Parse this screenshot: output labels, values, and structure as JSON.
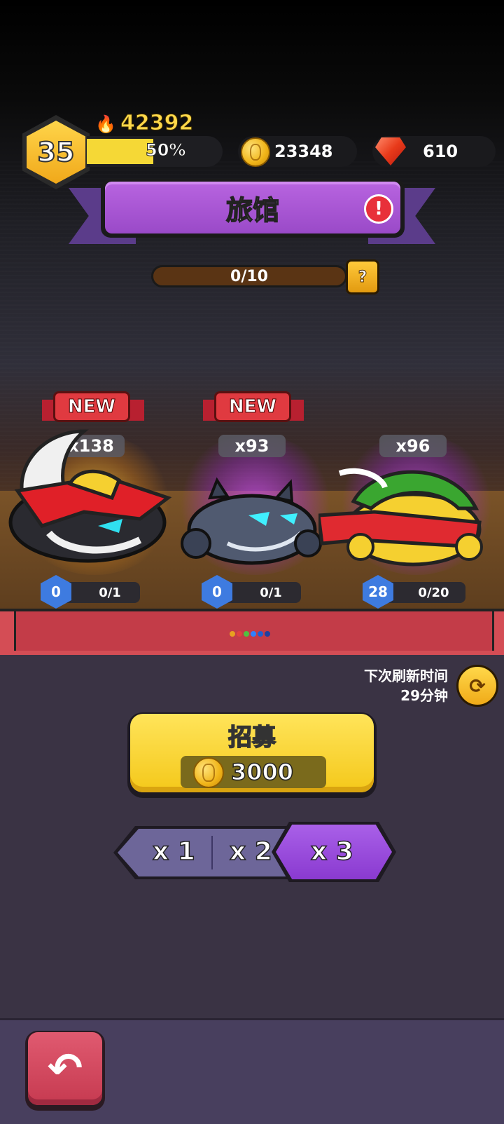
{
  "player": {
    "level": "35",
    "power": "42392",
    "xp_percent": "50%",
    "xp_fraction": 0.5
  },
  "resources": {
    "coins": "23348",
    "gems": "610"
  },
  "title": {
    "text": "旅馆",
    "alert": "!"
  },
  "progress": {
    "text": "0/10",
    "help": "?"
  },
  "heroes": [
    {
      "badge": "NEW",
      "count": "x138",
      "level": "0",
      "shards": "0/1",
      "glow": "#ffb020"
    },
    {
      "badge": "NEW",
      "count": "x93",
      "level": "0",
      "shards": "0/1",
      "glow": "#c040ff"
    },
    {
      "badge": "",
      "count": "x96",
      "level": "28",
      "shards": "0/20",
      "glow": "#c040ff"
    }
  ],
  "refresh": {
    "label": "下次刷新时间",
    "time": "29分钟"
  },
  "recruit": {
    "label": "招募",
    "cost": "3000"
  },
  "multiplier": {
    "options": [
      "x 1",
      "x 2",
      "x 3"
    ],
    "selected": "x 3"
  },
  "colors": {
    "accent_purple": "#9a4ac8",
    "gold": "#f4c81a",
    "red": "#e03a40"
  },
  "dots": [
    "#e8a020",
    "#e04040",
    "#50c040",
    "#3080ff",
    "#2060d0",
    "#2040a0"
  ]
}
